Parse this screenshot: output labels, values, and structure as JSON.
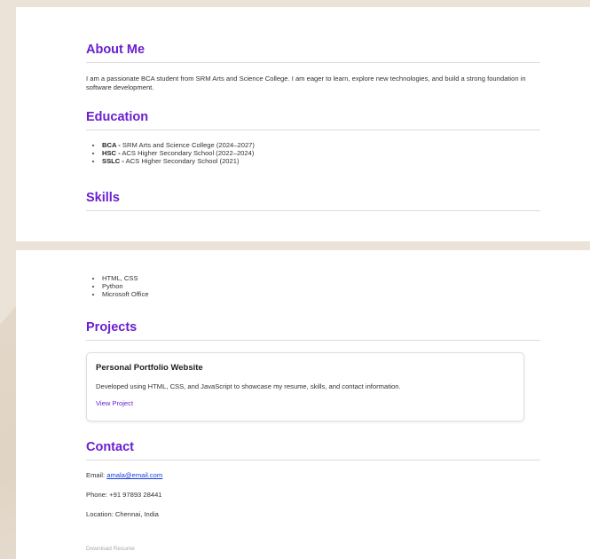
{
  "about": {
    "heading": "About Me",
    "text": "I am a passionate BCA student from SRM Arts and Science College. I am eager to learn, explore new technologies, and build a strong foundation in software development."
  },
  "education": {
    "heading": "Education",
    "items": [
      {
        "label": "BCA -",
        "detail": " SRM Arts and Science College (2024–2027)"
      },
      {
        "label": "HSC -",
        "detail": " ACS Higher Secondary School (2022–2024)"
      },
      {
        "label": "SSLC -",
        "detail": " ACS Higher Secondary School (2021)"
      }
    ]
  },
  "skills": {
    "heading": "Skills",
    "items": [
      "HTML, CSS",
      "Python",
      "Microsoft Office"
    ]
  },
  "projects": {
    "heading": "Projects",
    "card": {
      "title": "Personal Portfolio Website",
      "description": "Developed using HTML, CSS, and JavaScript to showcase my resume, skills, and contact information.",
      "link_label": "View Project"
    }
  },
  "contact": {
    "heading": "Contact",
    "email_label": "Email: ",
    "email": "amala@email.com",
    "phone": "Phone: +91 97893 28441",
    "location": "Location: Chennai, India",
    "download_label": "Download Resume"
  },
  "colors": {
    "accent": "#6a1fd0",
    "link": "#1a3fe0",
    "background": "#ebe3d8"
  }
}
